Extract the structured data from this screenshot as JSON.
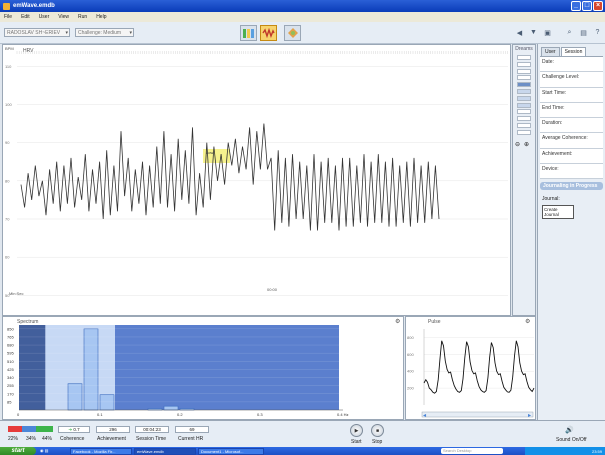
{
  "window": {
    "title": "emWave.emdb"
  },
  "menu": [
    "File",
    "Edit",
    "User",
    "View",
    "Run",
    "Help"
  ],
  "toolbar": {
    "user": "RADOSLAV SH~ERIEV",
    "challenge": "Challenge: Medium"
  },
  "hrv": {
    "label": "HRV",
    "ylabel": "BPM",
    "yticks": [
      "110",
      "100",
      "90",
      "80",
      "70",
      "60",
      "50"
    ],
    "xlabel": "Min:Sec",
    "xtick": "00:00",
    "highlight_label": "Low"
  },
  "chart_data": [
    {
      "type": "line",
      "title": "HRV",
      "ylabel": "BPM",
      "xlabel": "Min:Sec",
      "ylim": [
        48,
        114
      ],
      "yticks": [
        110,
        100,
        90,
        80,
        70,
        60,
        50
      ],
      "series": [
        {
          "values": [
            79,
            73,
            82,
            75,
            84,
            76,
            80,
            71,
            83,
            74,
            85,
            72,
            84,
            74,
            86,
            73,
            81,
            75,
            87,
            72,
            83,
            74,
            85,
            70,
            88,
            71,
            84,
            72,
            93,
            76,
            86,
            72,
            83,
            74,
            85,
            71,
            84,
            73,
            89,
            74,
            93,
            73,
            87,
            72,
            91,
            75,
            88,
            74,
            94,
            71,
            82,
            73,
            90,
            75,
            89,
            80,
            87,
            79,
            90,
            84,
            91,
            82,
            89,
            83,
            94,
            79,
            93,
            83,
            95,
            83,
            86,
            67,
            88,
            69,
            86,
            68,
            87,
            70,
            85,
            70,
            84,
            67,
            87,
            67,
            85,
            69,
            86,
            69,
            84,
            67,
            86,
            68,
            86,
            68,
            84,
            69,
            87,
            68,
            85,
            69,
            87,
            69,
            85,
            68,
            86,
            68,
            84,
            69,
            85,
            68,
            86,
            69,
            84,
            69,
            85,
            70,
            84,
            70
          ]
        }
      ]
    },
    {
      "type": "bar",
      "title": "Spectrum",
      "xlabel": "Hz",
      "x": [
        0.03,
        0.05,
        0.07,
        0.09,
        0.11,
        0.13,
        0.15,
        0.17,
        0.19,
        0.21
      ],
      "values": [
        0,
        0,
        275,
        850,
        160,
        0,
        0,
        15,
        40,
        15
      ],
      "xticks": [
        "0",
        "0.1",
        "0.2",
        "0.3",
        "0.4 Hz"
      ],
      "yticks": [
        "850",
        "765",
        "680",
        "595",
        "510",
        "425",
        "340",
        "255",
        "170",
        "85"
      ],
      "ylim": [
        0,
        890
      ]
    },
    {
      "type": "line",
      "title": "Pulse",
      "yticks": [
        "800",
        "600",
        "400",
        "200"
      ],
      "series": [
        {
          "values": [
            260,
            300,
            270,
            200,
            180,
            150,
            140,
            160,
            300,
            550,
            760,
            700,
            520,
            420,
            380,
            390,
            300,
            230,
            190,
            160,
            150,
            170,
            310,
            560,
            750,
            690,
            510,
            410,
            370,
            380,
            290,
            220,
            180,
            160,
            150,
            170,
            320,
            560,
            740,
            680,
            500,
            400,
            360,
            370,
            280,
            210,
            180,
            155,
            150,
            175,
            330,
            580,
            760,
            690,
            500,
            400,
            360,
            370,
            280,
            210,
            180,
            160,
            200
          ]
        }
      ]
    }
  ],
  "spectrum": {
    "label": "Spectrum"
  },
  "pulse": {
    "label": "Pulse"
  },
  "dreams": {
    "label": "Dreams"
  },
  "session_panel": {
    "tabs": [
      "User",
      "Session"
    ],
    "fields": [
      "Date:",
      "Challenge Level:",
      "Start Time:",
      "End Time:",
      "Duration:",
      "Average Coherence:",
      "Achievement:",
      "Device:"
    ],
    "section": "Journaling in Progress",
    "journal_label": "Journal:",
    "create_journal": "Create Journal"
  },
  "bottom": {
    "coherence_pcts": [
      "22%",
      "34%",
      "44%"
    ],
    "coherence_label": "Coherence",
    "coherence_value": "0.7",
    "achievement_value": "296",
    "achievement_label": "Achievement",
    "session_time_value": "00:04:23",
    "session_time_label": "Session Time",
    "current_hr_value": "69",
    "current_hr_label": "Current HR",
    "start_label": "Start",
    "stop_label": "Stop",
    "sound_label": "Sound On/Off"
  },
  "taskbar": {
    "start": "start",
    "tasks": [
      "Facebook - Mozilla Fir...",
      "emWave.emdb",
      "Document1 - Microsof..."
    ],
    "search_placeholder": "Search Desktop",
    "clock": "23:59"
  },
  "colors": {
    "window_title": "#0a3cb8",
    "spectrum_vlf": "#425f9c",
    "spectrum_lf": "#c7d9f5",
    "spectrum_hf": "#5b7fce",
    "coherence_red": "#e63b3b",
    "coherence_blue": "#4b86d8",
    "coherence_green": "#3cb44b"
  }
}
